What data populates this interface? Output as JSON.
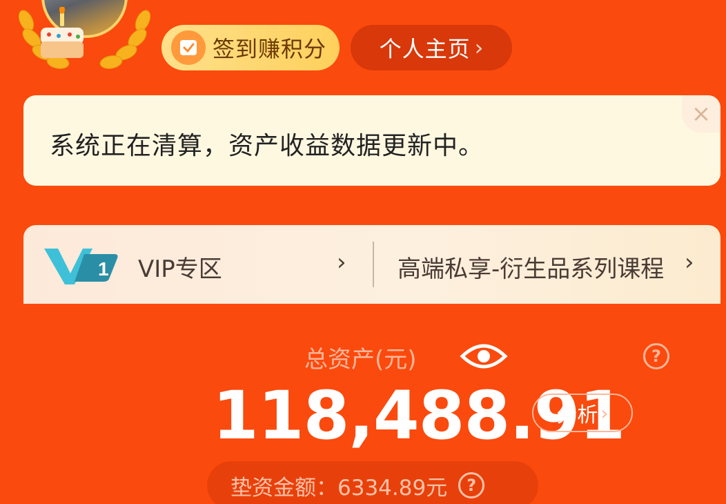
{
  "header": {
    "checkin_label": "签到赚积分",
    "profile_label": "个人主页",
    "chevron": "›"
  },
  "notice": {
    "text": "系统正在清算，资产收益数据更新中。",
    "close_symbol": "×"
  },
  "vip": {
    "logo_text": "1",
    "zone_label": "VIP专区",
    "course_label": "高端私享-衍生品系列课程",
    "chevron": "›"
  },
  "assets": {
    "title": "总资产(元)",
    "total": "118,488.91",
    "analyze_label": "分析",
    "analyze_chevron": "›",
    "help_symbol": "?",
    "pad_label": "垫资金额",
    "pad_value": "6334.89元",
    "pad_text": "垫资金额：6334.89元"
  },
  "colors": {
    "background": "#fb4a0d",
    "notice_bg": "#fff8e1",
    "checkin_bg": "#ffd05c",
    "profile_bg": "#d8380a"
  },
  "icons": [
    "laurel-icon",
    "cake-icon",
    "checkin-icon",
    "close-icon",
    "vip-logo-icon",
    "eye-icon",
    "help-icon"
  ]
}
